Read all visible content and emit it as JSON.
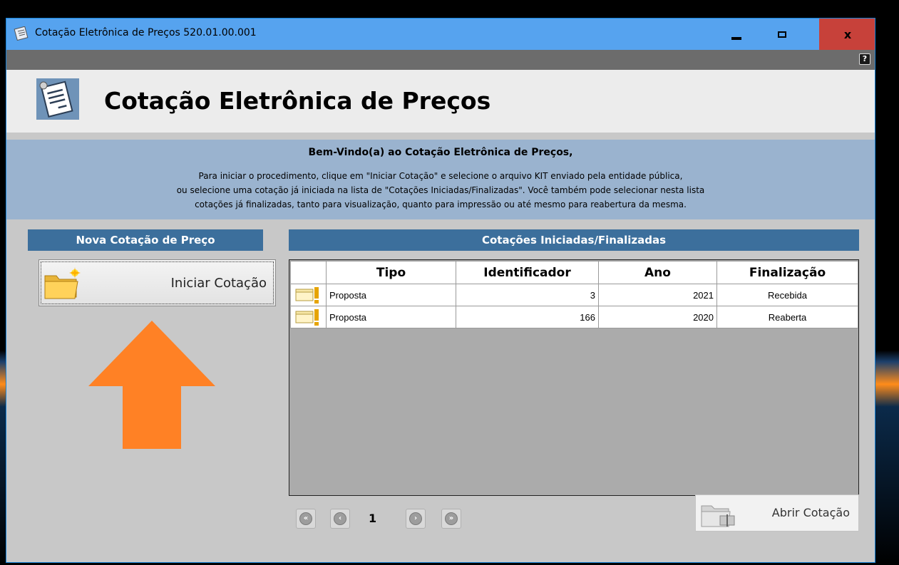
{
  "window": {
    "title": "Cotação Eletrônica de Preços 520.01.00.001",
    "minimize_icon": "minimize-icon",
    "maximize_icon": "maximize-icon",
    "close_label": "x"
  },
  "toolstrip": {
    "help_label": "?"
  },
  "header": {
    "title": "Cotação Eletrônica de Preços"
  },
  "welcome": {
    "title": "Bem-Vindo(a) ao Cotação Eletrônica de Preços,",
    "line1": "Para iniciar o procedimento, clique em \"Iniciar Cotação\" e selecione o arquivo KIT enviado pela entidade pública,",
    "line2": "ou selecione uma cotação já iniciada na lista de \"Cotações Iniciadas/Finalizadas\". Você também pode selecionar nesta lista",
    "line3": "cotações já finalizadas, tanto para visualização, quanto para impressão ou até mesmo para reabertura da mesma."
  },
  "left_panel": {
    "title": "Nova Cotação de Preço",
    "start_button_label": "Iniciar Cotação",
    "start_button_icon": "new-folder-icon",
    "arrow_color": "#ff8125"
  },
  "right_panel": {
    "title": "Cotações Iniciadas/Finalizadas",
    "columns": [
      "Tipo",
      "Identificador",
      "Ano",
      "Finalização"
    ],
    "rows": [
      {
        "tipo": "Proposta",
        "identificador": "3",
        "ano": "2021",
        "finalizacao": "Recebida"
      },
      {
        "tipo": "Proposta",
        "identificador": "166",
        "ano": "2020",
        "finalizacao": "Reaberta"
      }
    ],
    "pager": {
      "page": "1"
    },
    "open_button_label": "Abrir Cotação"
  },
  "colors": {
    "titlebar": "#56a3ef",
    "panel_header": "#3c6f9c",
    "welcome_band": "#9ab3cf",
    "close_button": "#c7413a"
  }
}
